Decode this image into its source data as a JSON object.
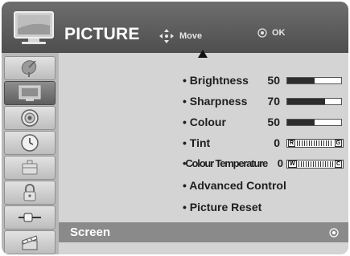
{
  "header": {
    "title": "PICTURE",
    "move_label": "Move",
    "ok_label": "OK",
    "icon": "tv-icon"
  },
  "sidebar": {
    "items": [
      {
        "icon": "satellite-dish-icon",
        "active": false
      },
      {
        "icon": "tv-icon",
        "active": true
      },
      {
        "icon": "speaker-icon",
        "active": false
      },
      {
        "icon": "clock-icon",
        "active": false
      },
      {
        "icon": "briefcase-icon",
        "active": false
      },
      {
        "icon": "lock-icon",
        "active": false
      },
      {
        "icon": "input-plug-icon",
        "active": false
      },
      {
        "icon": "clapperboard-icon",
        "active": false
      }
    ]
  },
  "menu": {
    "items": [
      {
        "label": "• Brightness",
        "value": "50",
        "level": 0.5,
        "control": "bar"
      },
      {
        "label": "• Sharpness",
        "value": "70",
        "level": 0.7,
        "control": "bar"
      },
      {
        "label": "• Colour",
        "value": "50",
        "level": 0.5,
        "control": "bar"
      },
      {
        "label": "• Tint",
        "value": "0",
        "control": "dial",
        "left_end": "R",
        "right_end": "G"
      },
      {
        "label": "•Colour Temperature",
        "value": "0",
        "control": "dial",
        "left_end": "W",
        "right_end": "C"
      },
      {
        "label": "• Advanced Control"
      },
      {
        "label": "• Picture Reset"
      }
    ]
  },
  "footer": {
    "selected_label": "Screen"
  },
  "colors": {
    "header_bg": "#5e5e5e",
    "panel_bg": "#d4d4d4",
    "sidebar_bg": "#b8b8b8",
    "selected_row": "#8a8a8a",
    "bar_fill": "#2d2d2d"
  }
}
